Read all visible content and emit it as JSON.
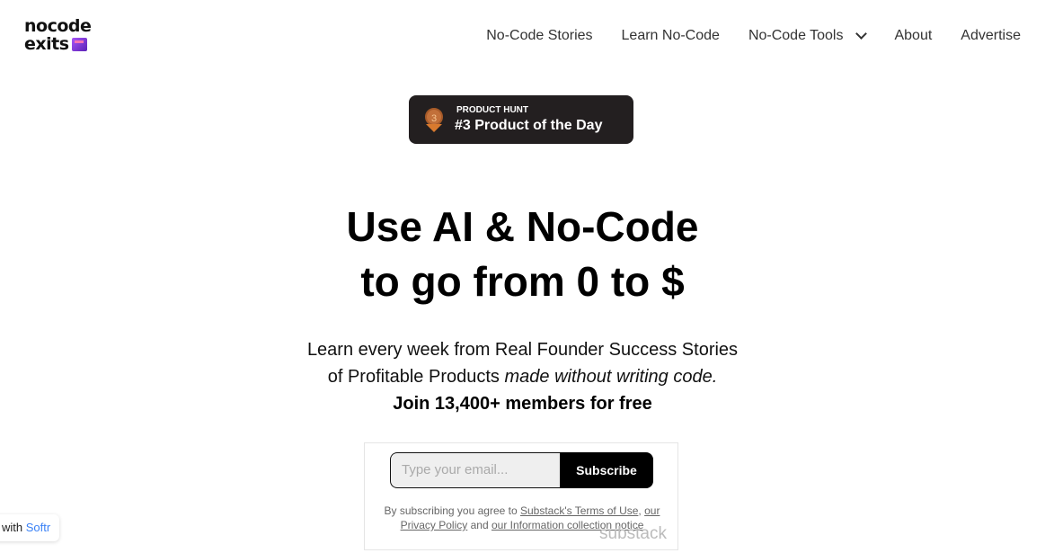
{
  "logo": {
    "line1": "nocode",
    "line2": "exits"
  },
  "nav": {
    "items": [
      "No-Code Stories",
      "Learn No-Code",
      "No-Code Tools",
      "About",
      "Advertise"
    ]
  },
  "badge": {
    "rank": "3",
    "small": "PRODUCT HUNT",
    "big": "#3 Product of the Day"
  },
  "hero": {
    "line1": "Use AI & No-Code",
    "line2": "to go from 0 to $"
  },
  "subtitle": {
    "line1": "Learn every week from Real Founder Success Stories",
    "line2a": "of Profitable Products ",
    "line2b": "made without writing code.",
    "line3": "Join 13,400+ members for free"
  },
  "form": {
    "placeholder": "Type your email...",
    "button": "Subscribe",
    "terms_prefix": "By subscribing you agree to ",
    "terms_link": "Substack's Terms of Use",
    "sep": ", ",
    "privacy": "our Privacy Policy",
    "and": " and ",
    "info": "our Information collection notice",
    "brand": "substack"
  },
  "softr": {
    "prefix": "with ",
    "name": "Softr"
  }
}
